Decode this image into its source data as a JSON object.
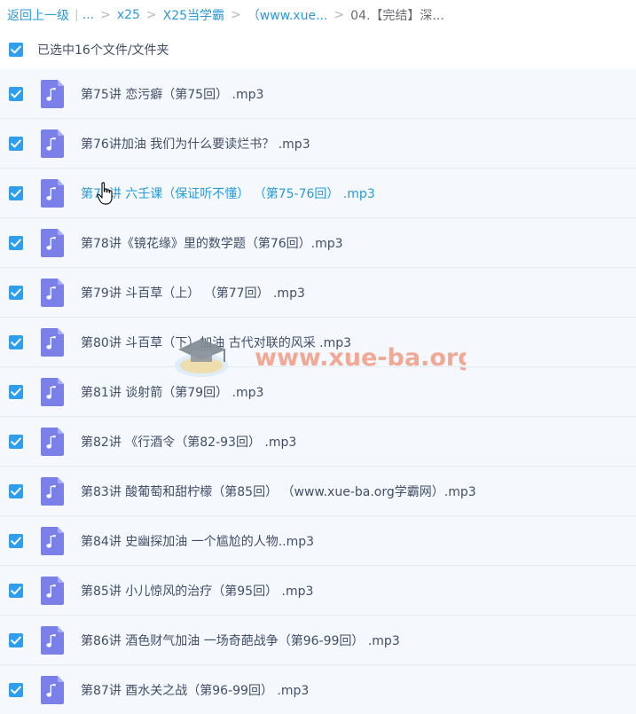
{
  "breadcrumb": {
    "back": "返回上一级",
    "pipe": "|",
    "ellipsis": "...",
    "sep": ">",
    "items": [
      "x25",
      "X25当学霸",
      "（www.xue...",
      "04.【完结】深..."
    ]
  },
  "selection": {
    "summary": "已选中16个文件/文件夹",
    "checked": true
  },
  "files": [
    {
      "name": "第75讲 恋污癖（第75回） .mp3",
      "icon": "music-file-icon",
      "checked": true
    },
    {
      "name": "第76讲加油 我们为什么要读烂书？ .mp3",
      "icon": "music-file-icon",
      "checked": true
    },
    {
      "name": "第77讲 六壬课（保证听不懂） （第75-76回） .mp3",
      "icon": "music-file-icon",
      "checked": true,
      "hovered": true
    },
    {
      "name": "第78讲《镜花缘》里的数学题（第76回）.mp3",
      "icon": "music-file-icon",
      "checked": true
    },
    {
      "name": "第79讲 斗百草（上） （第77回） .mp3",
      "icon": "music-file-icon",
      "checked": true
    },
    {
      "name": "第80讲 斗百草（下）加油 古代对联的风采 .mp3",
      "icon": "music-file-icon",
      "checked": true
    },
    {
      "name": "第81讲 谈射箭（第79回） .mp3",
      "icon": "music-file-icon",
      "checked": true
    },
    {
      "name": "第82讲 《行酒令（第82-93回） .mp3",
      "icon": "music-file-icon",
      "checked": true
    },
    {
      "name": "第83讲 酸葡萄和甜柠檬（第85回） （www.xue-ba.org学霸网）.mp3",
      "icon": "music-file-icon",
      "checked": true
    },
    {
      "name": "第84讲 史幽探加油 一个尴尬的人物..mp3",
      "icon": "music-file-icon",
      "checked": true
    },
    {
      "name": "第85讲 小儿惊风的治疗（第95回） .mp3",
      "icon": "music-file-icon",
      "checked": true
    },
    {
      "name": "第86讲 酒色财气加油 一场奇葩战争（第96-99回） .mp3",
      "icon": "music-file-icon",
      "checked": true
    },
    {
      "name": "第87讲 酉水关之战（第96-99回） .mp3",
      "icon": "music-file-icon",
      "checked": true
    }
  ],
  "watermark": {
    "text": "www.xue-ba.org"
  },
  "colors": {
    "accent": "#2a9ad8",
    "checkbox": "#2f9eec",
    "file_icon": "#7b80e8",
    "row_bg": "#f5f9fd",
    "text": "#424e67"
  }
}
